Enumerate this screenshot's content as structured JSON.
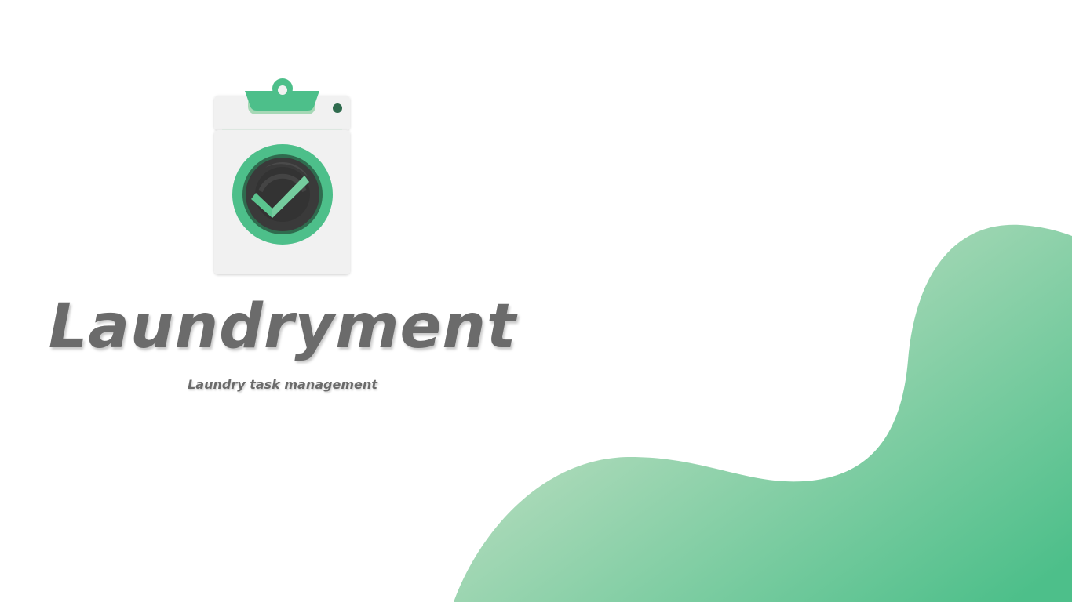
{
  "app": {
    "name": "Laundryment",
    "tagline": "Laundry task management"
  },
  "icons": {
    "logo": "washing-machine-clipboard-check-icon"
  },
  "colors": {
    "accent": "#4dbf8a",
    "accent_light": "#a6d8b6",
    "accent_dark": "#2f6b4e",
    "text": "#6b6b6b",
    "background": "#ffffff",
    "logo_body": "#f1f1f1",
    "drum": "#3a3a3a"
  }
}
